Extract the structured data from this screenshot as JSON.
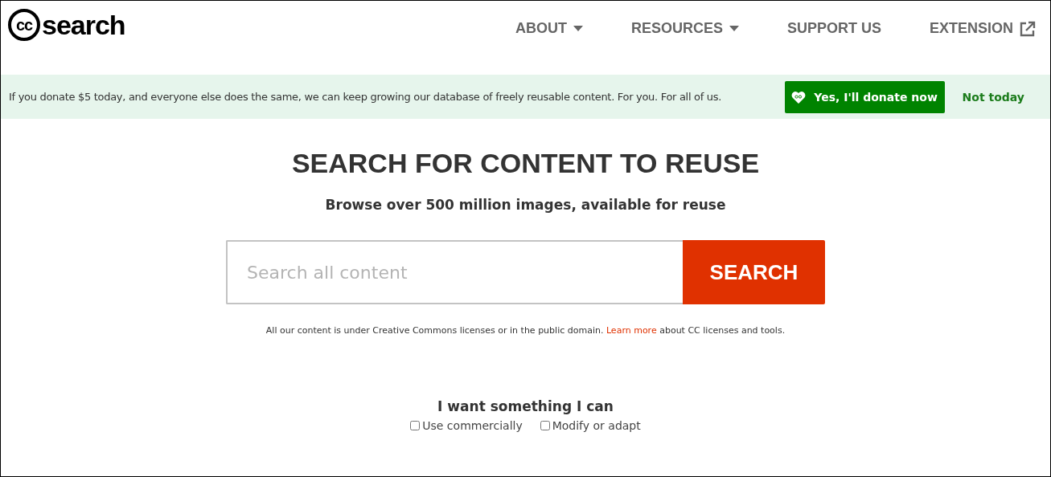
{
  "logo": {
    "mark": "cc",
    "text": "search"
  },
  "nav": [
    {
      "label": "ABOUT",
      "kind": "dropdown"
    },
    {
      "label": "RESOURCES",
      "kind": "dropdown"
    },
    {
      "label": "SUPPORT US",
      "kind": "plain"
    },
    {
      "label": "EXTENSION",
      "kind": "external"
    }
  ],
  "donation_banner": {
    "message": "If you donate $5 today, and everyone else does the same, we can keep growing our database of freely reusable content. For you. For all of us.",
    "donate_button": "Yes, I'll donate now",
    "dismiss_link": "Not today"
  },
  "hero": {
    "title": "SEARCH FOR CONTENT TO REUSE",
    "subtitle": "Browse over 500 million images, available for reuse"
  },
  "search": {
    "placeholder": "Search all content",
    "button": "SEARCH"
  },
  "license_note": {
    "before": "All our content is under Creative Commons licenses or in the public domain.",
    "link": "Learn more",
    "after": "about CC licenses and tools."
  },
  "filters": {
    "heading": "I want something I can",
    "options": [
      {
        "label": "Use commercially",
        "checked": false
      },
      {
        "label": "Modify or adapt",
        "checked": false
      }
    ]
  }
}
